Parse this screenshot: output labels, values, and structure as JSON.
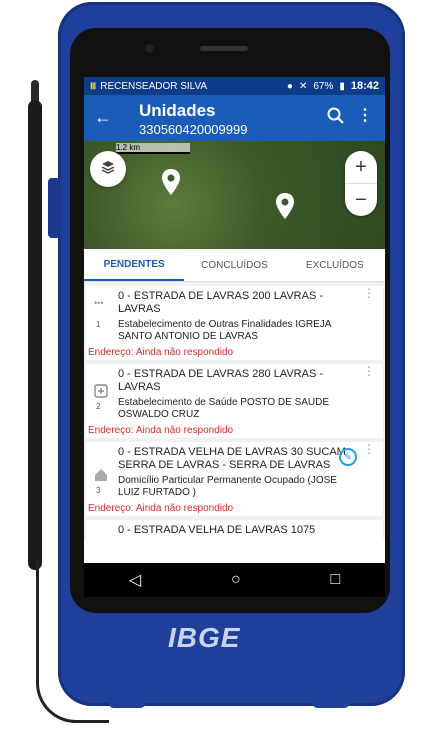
{
  "status_bar": {
    "user": "RECENSEADOR SILVA",
    "battery": "67%",
    "time": "18:42"
  },
  "app_bar": {
    "title": "Unidades",
    "subtitle": "330560420009999"
  },
  "map": {
    "scale": "1.2 km"
  },
  "tabs": [
    {
      "label": "PENDENTES"
    },
    {
      "label": "CONCLUÍDOS"
    },
    {
      "label": "EXCLUÍDOS"
    }
  ],
  "units": [
    {
      "address": "0 - ESTRADA DE LAVRAS 200 LAVRAS - LAVRAS",
      "number": "1",
      "description": "Estabelecimento de Outras Finalidades IGREJA SANTO ANTONIO DE LAVRAS",
      "status": "Endereço: Ainda não respondido"
    },
    {
      "address": "0 - ESTRADA DE LAVRAS 280 LAVRAS - LAVRAS",
      "number": "2",
      "description": "Estabelecimento de Saúde POSTO DE SAUDE OSWALDO CRUZ",
      "status": "Endereço: Ainda não respondido"
    },
    {
      "address": "0 - ESTRADA VELHA DE LAVRAS 30 SUCAM SERRA DE LAVRAS - SERRA DE LAVRAS",
      "number": "3",
      "description": "Domicílio Particular Permanente Ocupado (JOSE LUIZ FURTADO )",
      "status": "Endereço: Ainda não respondido"
    },
    {
      "address": "0 - ESTRADA VELHA DE LAVRAS 1075"
    }
  ],
  "brand": "IBGE",
  "colors": {
    "primary": "#1a5cb8",
    "status_bar": "#0d3d8a",
    "warning": "#d42b2b",
    "case": "#1f3f9a"
  }
}
